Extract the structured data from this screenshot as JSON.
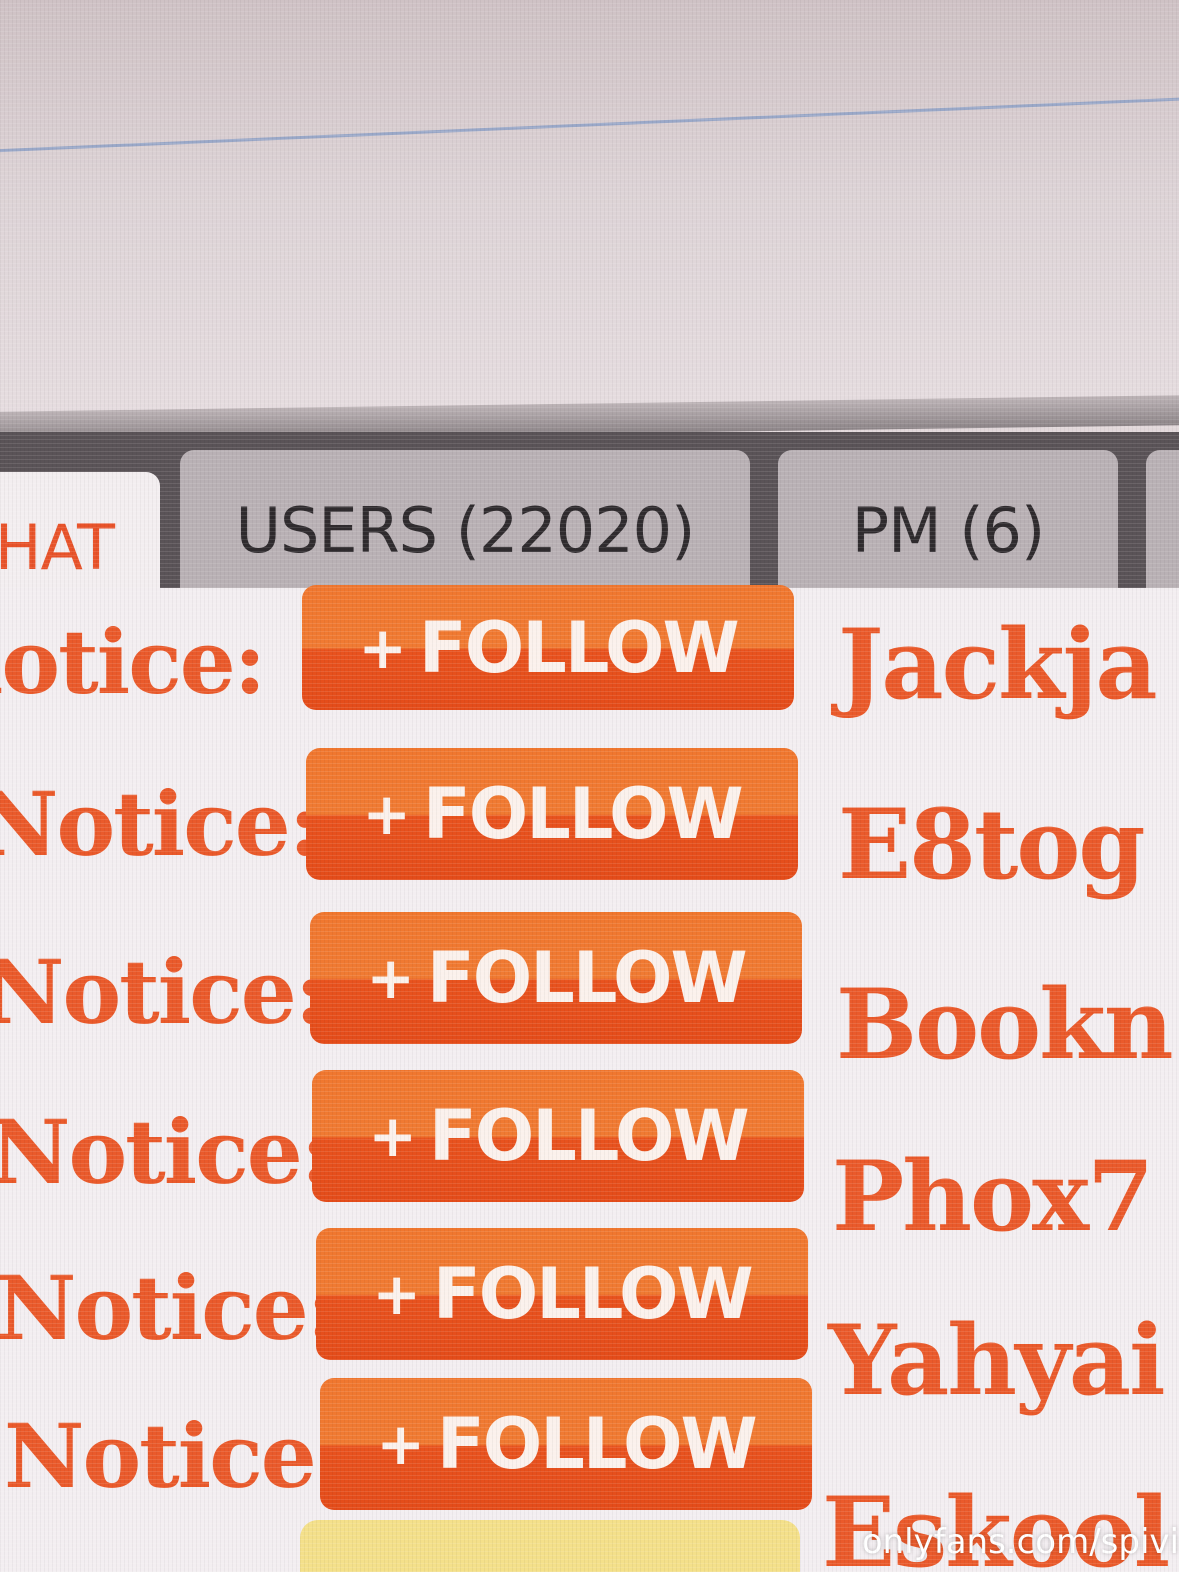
{
  "tabs": {
    "chat": "HAT",
    "users": "USERS (22020)",
    "pm": "PM (6)"
  },
  "messages": [
    {
      "notice": "lotice:",
      "follow": "FOLLOW",
      "username": "Jackja"
    },
    {
      "notice": "Notice:",
      "follow": "FOLLOW",
      "username": "E8tog"
    },
    {
      "notice": "Notice:",
      "follow": "FOLLOW",
      "username": "Bookn"
    },
    {
      "notice": "Notice:",
      "follow": "FOLLOW",
      "username": "Phox7"
    },
    {
      "notice": "Notice:",
      "follow": "FOLLOW",
      "username": "Yahyai"
    },
    {
      "notice": "Notice:",
      "follow": "FOLLOW",
      "username": "Eskool"
    }
  ],
  "follow_plus": "+",
  "watermark": "onlyfans.com/spivi",
  "colors": {
    "accent": "#ea5a2b",
    "button_top": "#f07a32",
    "button_bottom": "#e44c1a",
    "tab_active_bg": "#f3eef0",
    "tab_inactive_bg": "#b9b1b5"
  }
}
